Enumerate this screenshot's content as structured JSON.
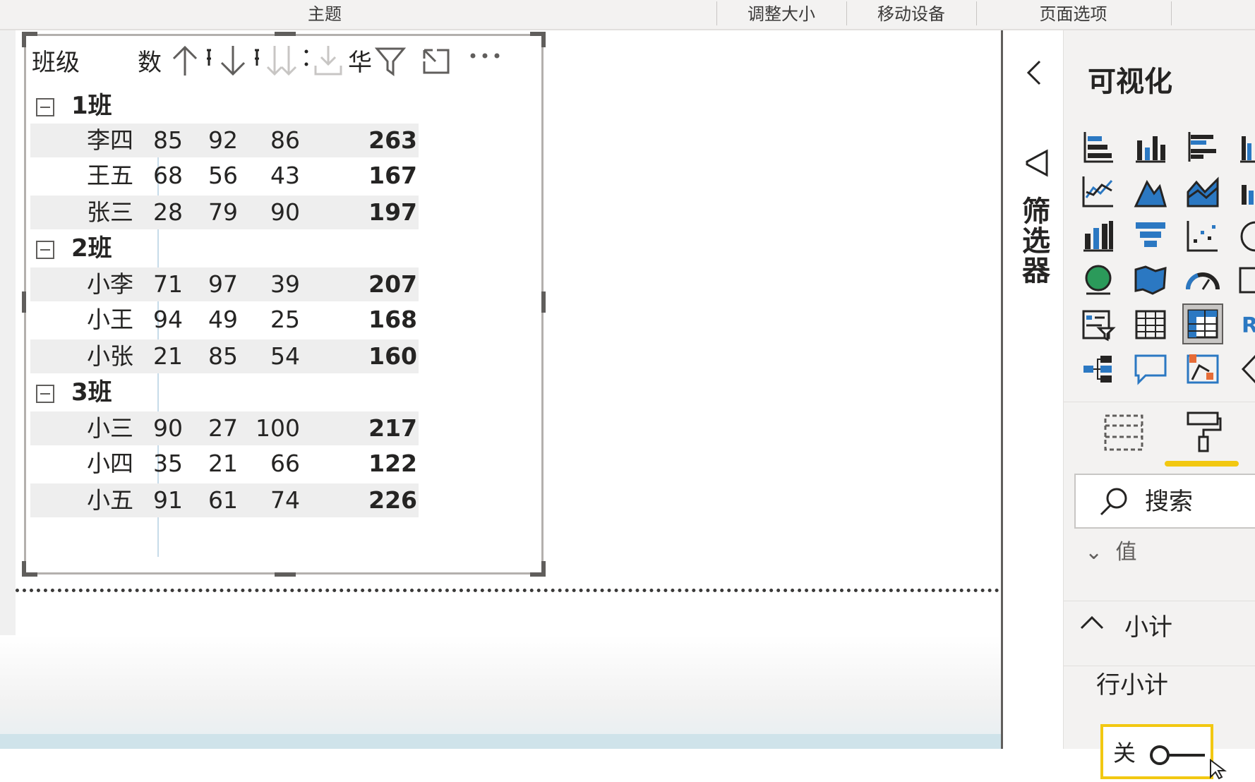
{
  "ribbon": {
    "groups": [
      {
        "label": "主题"
      },
      {
        "label": "调整大小"
      },
      {
        "label": "移动设备"
      },
      {
        "label": "页面选项"
      }
    ]
  },
  "visual": {
    "header": {
      "row_header": "班级",
      "column_header": "数",
      "total_header": "华"
    },
    "icons": [
      "sort-ascending-icon",
      "sort-descending-icon",
      "drill-down-icon",
      "expand-level-icon",
      "filter-icon",
      "focus-mode-icon",
      "more-options-icon"
    ],
    "groups": [
      {
        "label": "1班",
        "rows": [
          {
            "name": "李四",
            "v1": "85",
            "v2": "92",
            "v3": "86",
            "total": "263"
          },
          {
            "name": "王五",
            "v1": "68",
            "v2": "56",
            "v3": "43",
            "total": "167"
          },
          {
            "name": "张三",
            "v1": "28",
            "v2": "79",
            "v3": "90",
            "total": "197"
          }
        ]
      },
      {
        "label": "2班",
        "rows": [
          {
            "name": "小李",
            "v1": "71",
            "v2": "97",
            "v3": "39",
            "total": "207"
          },
          {
            "name": "小王",
            "v1": "94",
            "v2": "49",
            "v3": "25",
            "total": "168"
          },
          {
            "name": "小张",
            "v1": "21",
            "v2": "85",
            "v3": "54",
            "total": "160"
          }
        ]
      },
      {
        "label": "3班",
        "rows": [
          {
            "name": "小三",
            "v1": "90",
            "v2": "27",
            "v3": "100",
            "total": "217"
          },
          {
            "name": "小四",
            "v1": "35",
            "v2": "21",
            "v3": "66",
            "total": "122"
          },
          {
            "name": "小五",
            "v1": "91",
            "v2": "61",
            "v3": "74",
            "total": "226"
          }
        ]
      }
    ]
  },
  "filters": {
    "label": "筛选器"
  },
  "visualizations": {
    "title": "可视化",
    "icons": [
      "stacked-bar-chart-icon",
      "stacked-column-chart-icon",
      "clustered-bar-chart-icon",
      "clustered-column-chart-icon",
      "line-chart-icon",
      "area-chart-icon",
      "stacked-area-chart-icon",
      "line-column-chart-icon",
      "ribbon-chart-icon",
      "funnel-chart-icon",
      "scatter-chart-icon",
      "pie-chart-icon",
      "map-icon",
      "filled-map-icon",
      "gauge-icon",
      "card-icon",
      "slicer-icon",
      "table-icon",
      "matrix-icon",
      "r-visual-icon",
      "decomposition-tree-icon",
      "qna-icon",
      "key-influencers-icon",
      "shape-icon"
    ],
    "selected_icon": "matrix-icon",
    "tabs": [
      "fields-tab-icon",
      "format-tab-icon"
    ],
    "active_tab": "format-tab-icon",
    "search_placeholder": "搜索",
    "partial_section": "值",
    "section": "小计",
    "property": "行小计",
    "toggle": {
      "state_label": "关",
      "value": "off"
    },
    "accent_color": "#f2c811"
  }
}
